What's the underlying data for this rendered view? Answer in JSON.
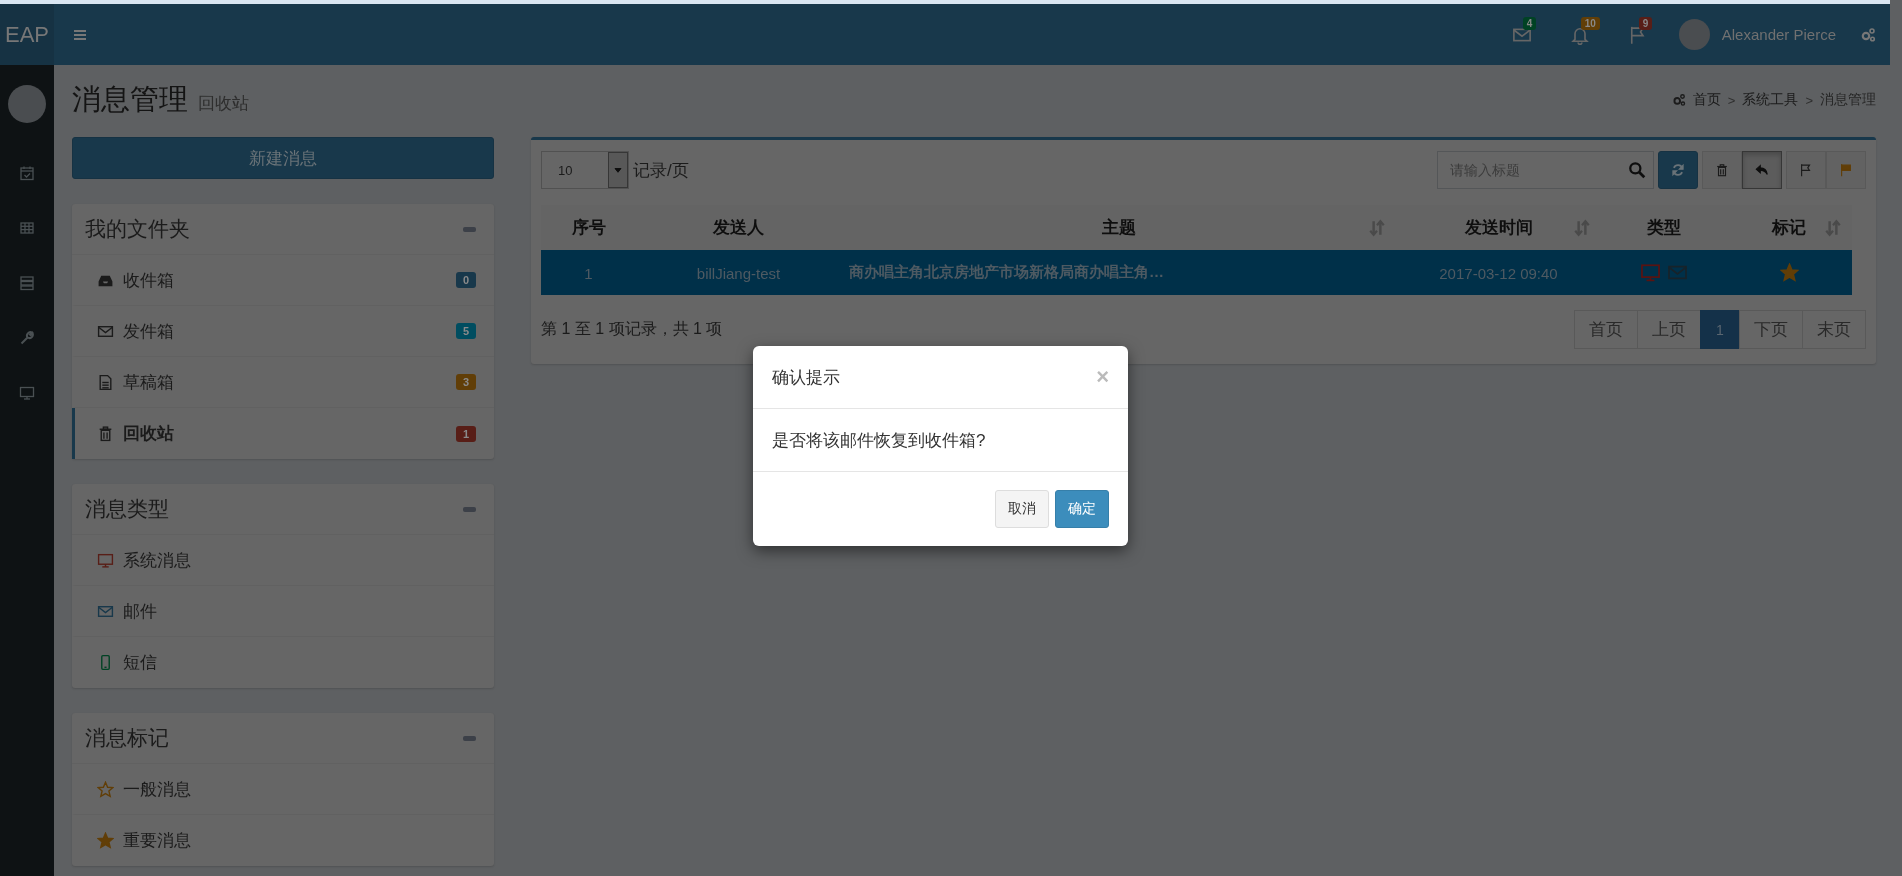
{
  "header": {
    "logo": "EAP",
    "notifications": [
      {
        "kind": "mail",
        "count": "4",
        "color": "#004224"
      },
      {
        "kind": "bell",
        "count": "10",
        "color": "#613e07"
      },
      {
        "kind": "flag",
        "count": "9",
        "color": "#581e17"
      }
    ],
    "user": {
      "name": "Alexander Pierce"
    }
  },
  "sidebar": {
    "items": [
      {
        "kind": "calendar"
      },
      {
        "kind": "table"
      },
      {
        "kind": "server"
      },
      {
        "kind": "wrench"
      },
      {
        "kind": "monitor"
      }
    ]
  },
  "page": {
    "title": "消息管理",
    "subtitle": "回收站",
    "breadcrumb": [
      "首页",
      "系统工具",
      "消息管理"
    ],
    "separator": ">"
  },
  "new_button": "新建消息",
  "panels": [
    {
      "title": "我的文件夹",
      "items": [
        {
          "kind": "inbox",
          "label": "收件箱",
          "count": "0",
          "color": "#18384b",
          "selected": false
        },
        {
          "kind": "envelope",
          "label": "发件箱",
          "count": "5",
          "color": "#004d60",
          "selected": false
        },
        {
          "kind": "file",
          "label": "草稿箱",
          "count": "3",
          "color": "#613e07",
          "selected": false
        },
        {
          "kind": "trash",
          "label": "回收站",
          "count": "1",
          "color": "#581e17",
          "selected": true
        }
      ]
    },
    {
      "title": "消息类型",
      "items": [
        {
          "kind": "monitor",
          "label": "系统消息",
          "color": "#581e17"
        },
        {
          "kind": "envelope",
          "label": "邮件",
          "color": "#18384b"
        },
        {
          "kind": "mobile",
          "label": "短信",
          "color": "#004224"
        }
      ]
    },
    {
      "title": "消息标记",
      "items": [
        {
          "kind": "star-outline",
          "label": "一般消息",
          "color": "#613e07"
        },
        {
          "kind": "star",
          "label": "重要消息",
          "color": "#613e07"
        }
      ]
    }
  ],
  "mailbox": {
    "page_size": "10",
    "page_size_label": "记录/页",
    "search_placeholder": "请输入标题",
    "tool_groups": [
      {
        "buttons": [
          {
            "kind": "refresh",
            "active": false
          }
        ]
      },
      {
        "buttons": [
          {
            "kind": "delete",
            "active": false
          },
          {
            "kind": "restore",
            "active": true
          }
        ]
      },
      {
        "buttons": [
          {
            "kind": "normal",
            "active": false
          },
          {
            "kind": "important",
            "active": false
          }
        ]
      }
    ],
    "columns": [
      {
        "label": "序号",
        "sortable": false
      },
      {
        "label": "发送人",
        "sortable": false
      },
      {
        "label": "主题",
        "sortable": true
      },
      {
        "label": "发送时间",
        "sortable": true
      },
      {
        "label": "类型",
        "sortable": false
      },
      {
        "label": "标记",
        "sortable": true
      }
    ],
    "rows": [
      {
        "index": "1",
        "sender": "billJiang-test",
        "subject": "商办唱主角北京房地产市场新格局商办唱主角…",
        "time": "2017-03-12 09:40",
        "types": [
          {
            "kind": "monitor",
            "active": true
          },
          {
            "kind": "envelope",
            "active": false
          }
        ],
        "starred": true,
        "selected": true
      }
    ],
    "info": "第 1 至 1 项记录，共 1 项",
    "pagination": [
      {
        "label": "首页",
        "selected": false
      },
      {
        "label": "上页",
        "selected": false
      },
      {
        "label": "1",
        "selected": true
      },
      {
        "label": "下页",
        "selected": false
      },
      {
        "label": "末页",
        "selected": false
      }
    ]
  },
  "modal": {
    "title": "确认提示",
    "close": "×",
    "message": "是否将该邮件恢复到收件箱?",
    "buttons": [
      {
        "label": "取消",
        "kind": "cancel"
      },
      {
        "label": "确定",
        "kind": "confirm"
      }
    ]
  }
}
